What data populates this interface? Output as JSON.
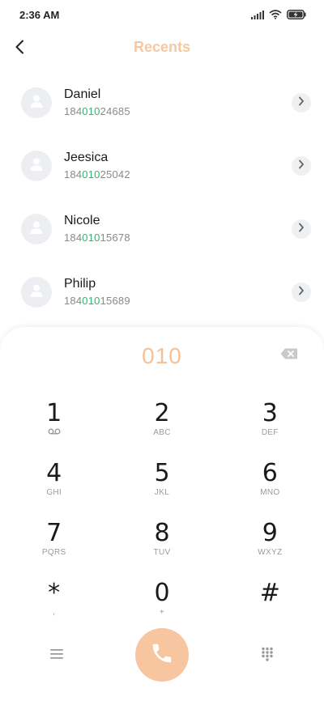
{
  "status_bar": {
    "time": "2:36 AM",
    "icons": [
      "signal-icon",
      "wifi-icon",
      "battery-charging-icon"
    ]
  },
  "header": {
    "title": "Recents",
    "back_icon": "back-arrow-icon"
  },
  "contacts": [
    {
      "name": "Daniel",
      "number_prefix": "184",
      "number_match": "010",
      "number_suffix": "24685"
    },
    {
      "name": "Jeesica",
      "number_prefix": "184",
      "number_match": "010",
      "number_suffix": "25042"
    },
    {
      "name": "Nicole",
      "number_prefix": "184",
      "number_match": "010",
      "number_suffix": "15678"
    },
    {
      "name": "Philip",
      "number_prefix": "184",
      "number_match": "010",
      "number_suffix": "15689"
    }
  ],
  "dialpad": {
    "dialed": "010",
    "keys": [
      {
        "digit": "1",
        "letters": ""
      },
      {
        "digit": "2",
        "letters": "ABC"
      },
      {
        "digit": "3",
        "letters": "DEF"
      },
      {
        "digit": "4",
        "letters": "GHI"
      },
      {
        "digit": "5",
        "letters": "JKL"
      },
      {
        "digit": "6",
        "letters": "MNO"
      },
      {
        "digit": "7",
        "letters": "PQRS"
      },
      {
        "digit": "8",
        "letters": "TUV"
      },
      {
        "digit": "9",
        "letters": "WXYZ"
      },
      {
        "digit": "*",
        "letters": ","
      },
      {
        "digit": "0",
        "letters": "+"
      },
      {
        "digit": "#",
        "letters": ""
      }
    ]
  },
  "colors": {
    "accent": "#f7c6a0",
    "title": "#f7c89f",
    "match": "#2bb673",
    "dialed": "#f3c19a"
  }
}
